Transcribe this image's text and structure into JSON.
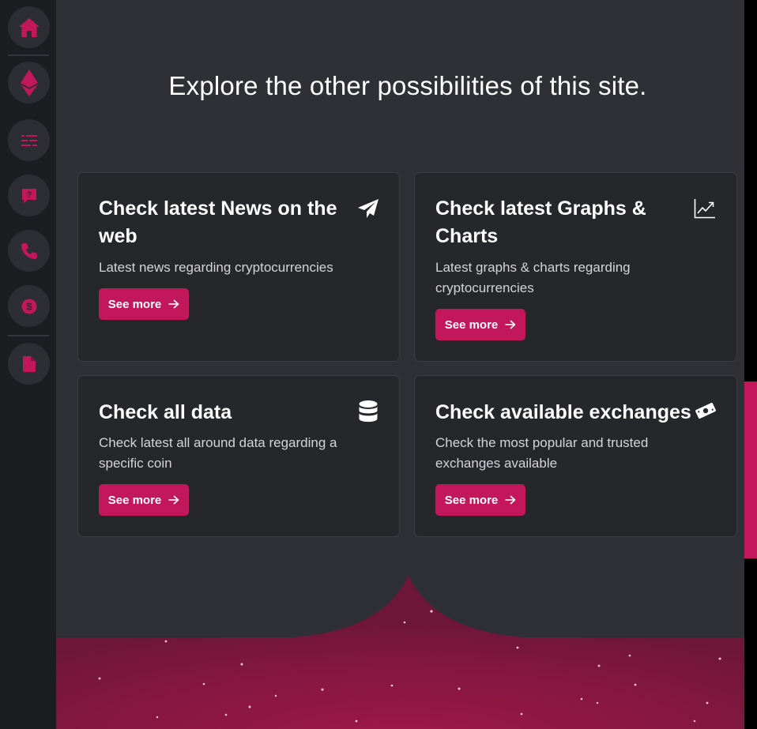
{
  "sidebar": {
    "items": [
      {
        "name": "home-icon"
      },
      {
        "name": "ethereum-icon"
      },
      {
        "name": "list-icon"
      },
      {
        "name": "question-icon"
      },
      {
        "name": "phone-icon"
      },
      {
        "name": "dollar-coin-icon"
      },
      {
        "name": "file-icon"
      }
    ]
  },
  "main": {
    "heading": "Explore the other possibilities of this site.",
    "cards": [
      {
        "title": "Check latest News on the web",
        "description": "Latest news regarding cryptocurrencies",
        "button": "See more",
        "icon": "paper-plane-icon"
      },
      {
        "title": "Check latest Graphs & Charts",
        "description": "Latest graphs & charts regarding cryptocurrencies",
        "button": "See more",
        "icon": "chart-line-icon"
      },
      {
        "title": "Check all data",
        "description": "Check latest all around data regarding a specific coin",
        "button": "See more",
        "icon": "database-icon"
      },
      {
        "title": "Check available exchanges",
        "description": "Check the most popular and trusted exchanges available",
        "button": "See more",
        "icon": "money-bill-icon"
      }
    ]
  },
  "colors": {
    "accent": "#c2185b",
    "background": "#2f3035",
    "card": "#26272b",
    "sidebar": "#1c1d21"
  }
}
